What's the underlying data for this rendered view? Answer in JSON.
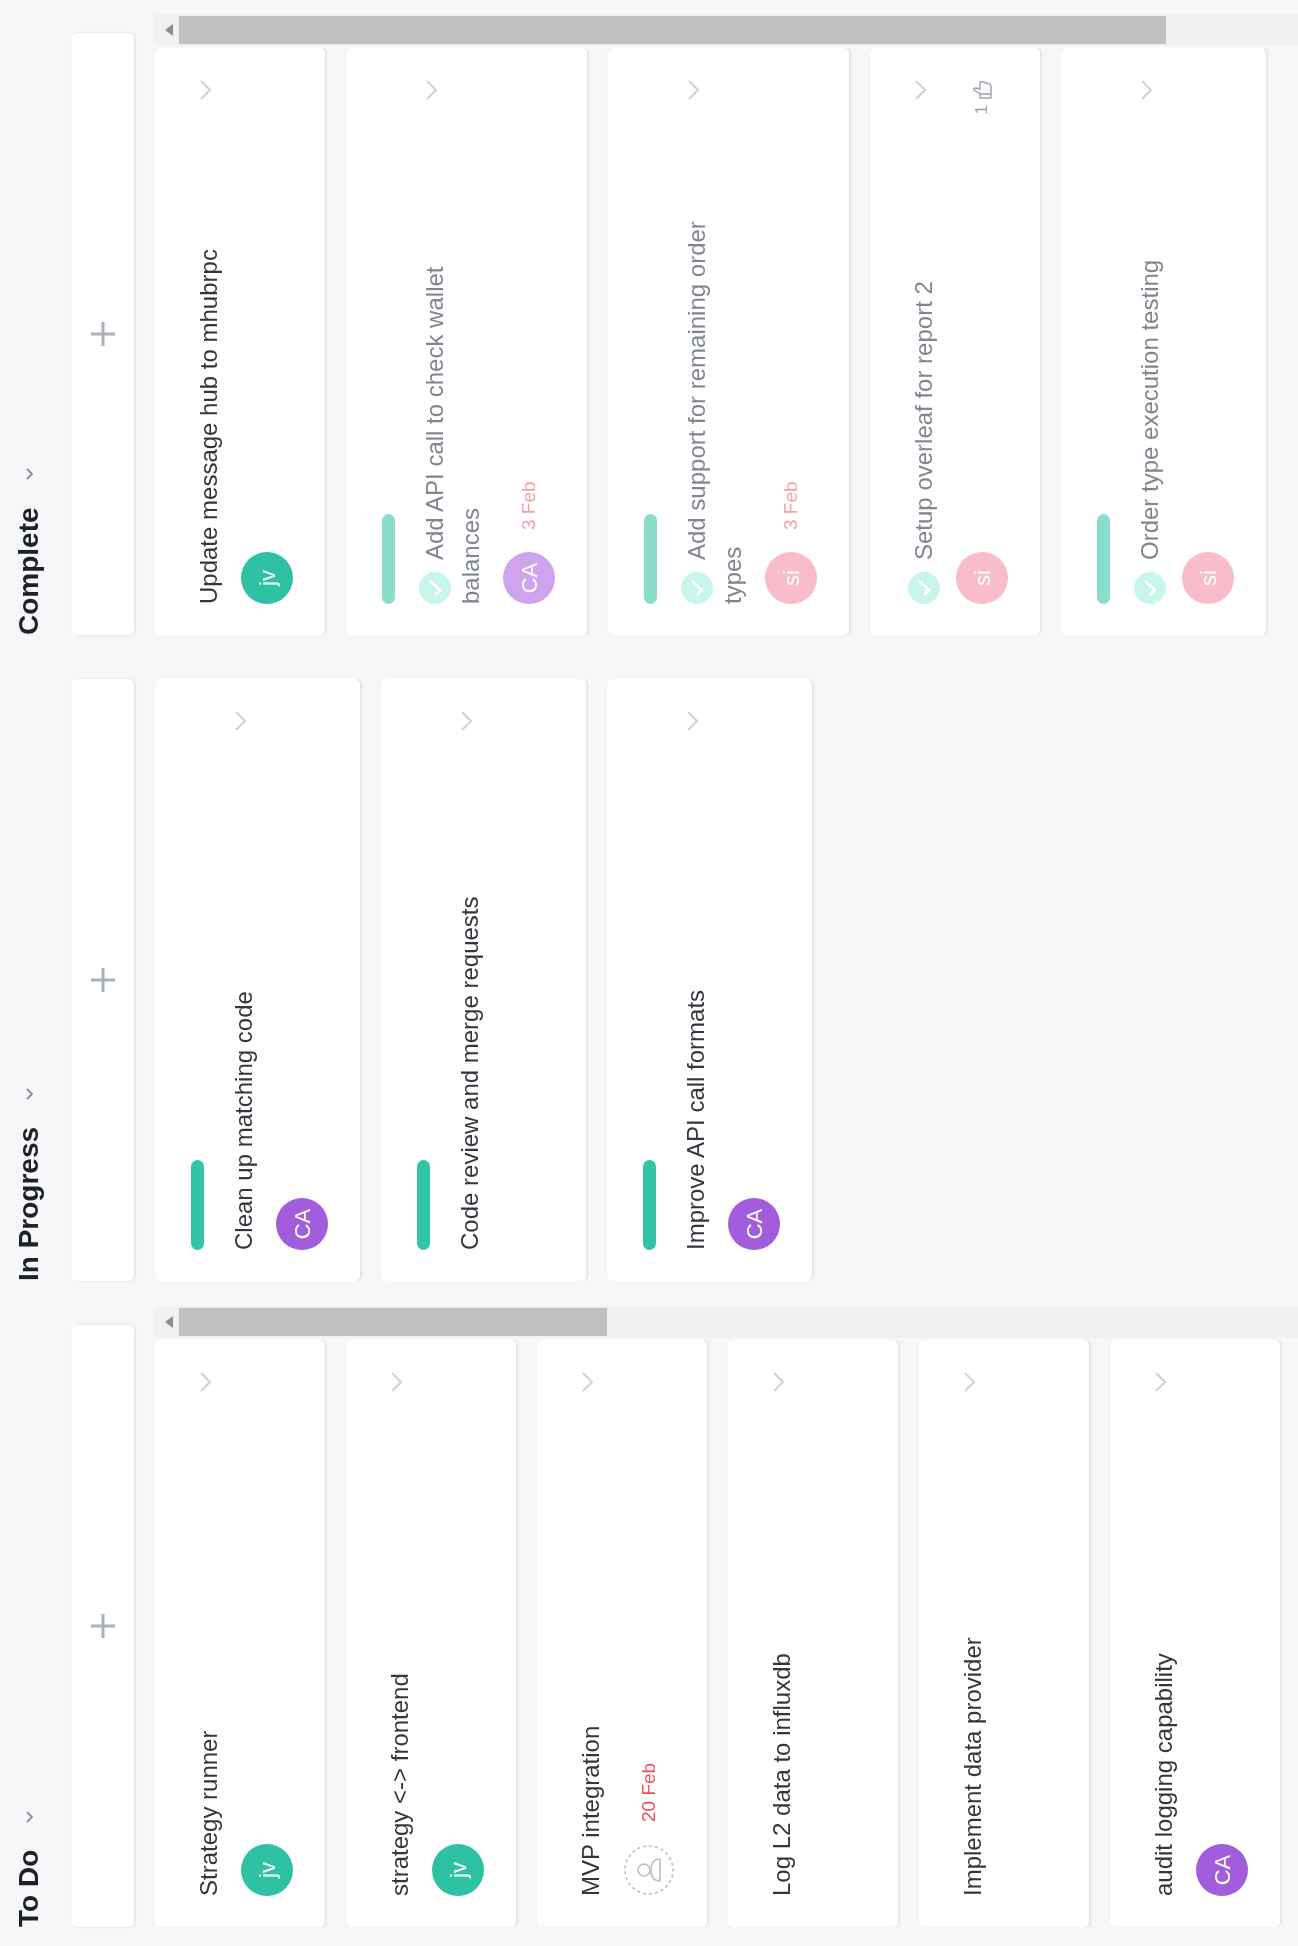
{
  "columns": [
    {
      "title": "To Do",
      "scrollbar": true,
      "cards": [
        {
          "title": "Strategy runner",
          "tag": false,
          "completed": false,
          "assignee": {
            "kind": "user",
            "initials": "jv",
            "color": "#2fc1a4"
          }
        },
        {
          "title": "strategy <-> frontend",
          "tag": false,
          "completed": false,
          "assignee": {
            "kind": "user",
            "initials": "jv",
            "color": "#2fc1a4"
          }
        },
        {
          "title": "MVP integration",
          "tag": false,
          "completed": false,
          "assignee": {
            "kind": "unassigned"
          },
          "due": "20 Feb"
        },
        {
          "title": "Log L2 data to influxdb",
          "tag": false,
          "completed": false
        },
        {
          "title": "Implement data provider",
          "tag": false,
          "completed": false
        },
        {
          "title": "audit logging capability",
          "tag": false,
          "completed": false,
          "assignee": {
            "kind": "user",
            "initials": "CA",
            "color": "#a25ddc"
          }
        }
      ]
    },
    {
      "title": "In Progress",
      "scrollbar": false,
      "cards": [
        {
          "title": "Clean up matching code",
          "tag": true,
          "completed": false,
          "assignee": {
            "kind": "user",
            "initials": "CA",
            "color": "#a25ddc"
          }
        },
        {
          "title": "Code review and merge requests",
          "tag": true,
          "completed": false
        },
        {
          "title": "Improve API call formats",
          "tag": true,
          "completed": false,
          "assignee": {
            "kind": "user",
            "initials": "CA",
            "color": "#a25ddc"
          }
        }
      ]
    },
    {
      "title": "Complete",
      "scrollbar": true,
      "cards": [
        {
          "title": "Update message hub to mhubrpc",
          "tag": false,
          "completed": false,
          "assignee": {
            "kind": "user",
            "initials": "jv",
            "color": "#2fc1a4"
          }
        },
        {
          "title": "Add API call to check wallet balances",
          "tag": true,
          "completed": true,
          "assignee": {
            "kind": "user",
            "initials": "CA",
            "color": "#cfa3ee"
          },
          "due": "3 Feb"
        },
        {
          "title": "Add support for remaining order types",
          "tag": true,
          "completed": true,
          "assignee": {
            "kind": "user",
            "initials": "si",
            "color": "#f9bccb"
          },
          "due": "3 Feb"
        },
        {
          "title": "Setup overleaf for report 2",
          "tag": false,
          "completed": true,
          "assignee": {
            "kind": "user",
            "initials": "si",
            "color": "#f9bccb"
          },
          "likes": "1"
        },
        {
          "title": "Order type execution testing",
          "tag": true,
          "completed": true,
          "assignee": {
            "kind": "user",
            "initials": "si",
            "color": "#f9bccb"
          }
        }
      ]
    }
  ]
}
